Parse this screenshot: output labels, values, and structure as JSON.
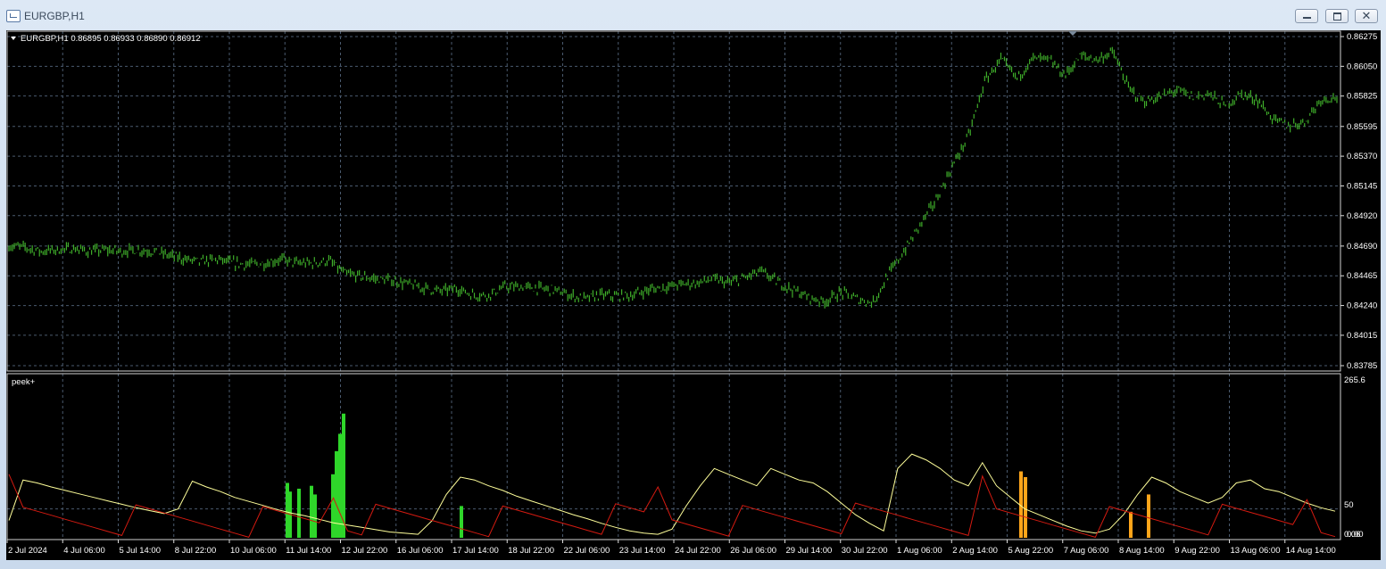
{
  "window": {
    "title": "EURGBP,H1",
    "minimize_label": "",
    "maximize_label": "",
    "close_label": "✕"
  },
  "price_panel": {
    "header": "EURGBP,H1  0.86895 0.86933 0.86890 0.86912",
    "y_ticks": [
      "0.86275",
      "0.86050",
      "0.85825",
      "0.85595",
      "0.85370",
      "0.85145",
      "0.84920",
      "0.84690",
      "0.84465",
      "0.84240",
      "0.84015",
      "0.83785"
    ]
  },
  "indicator_panel": {
    "name": "peek+",
    "y_ticks": [
      "265.6",
      "50",
      "0.06",
      "0.00"
    ]
  },
  "time_axis": [
    "2 Jul 2024",
    "4 Jul 06:00",
    "5 Jul 14:00",
    "8 Jul 22:00",
    "10 Jul 06:00",
    "11 Jul 14:00",
    "12 Jul 22:00",
    "16 Jul 06:00",
    "17 Jul 14:00",
    "18 Jul 22:00",
    "22 Jul 06:00",
    "23 Jul 14:00",
    "24 Jul 22:00",
    "26 Jul 06:00",
    "29 Jul 14:00",
    "30 Jul 22:00",
    "1 Aug 06:00",
    "2 Aug 14:00",
    "5 Aug 22:00",
    "7 Aug 06:00",
    "8 Aug 14:00",
    "9 Aug 22:00",
    "13 Aug 06:00",
    "14 Aug 14:00"
  ],
  "colors": {
    "background": "#000000",
    "grid": "#4a5a6e",
    "price_bars": "#3fae2a",
    "text": "#ffffff",
    "line_yellow": "#ffff9a",
    "line_red": "#d41a10",
    "hist_green": "#2fd62a",
    "hist_orange": "#ffa51a"
  },
  "chart_data": {
    "type": "line",
    "series": [
      {
        "values": [
          0.8469,
          0.8468,
          0.8465,
          0.8466,
          0.8467,
          0.8465,
          0.8466,
          0.8465,
          0.8466,
          0.8465,
          0.8462,
          0.8459,
          0.8457,
          0.8459,
          0.8456,
          0.8455,
          0.8456,
          0.8459,
          0.8456,
          0.8456,
          0.8458,
          0.8448,
          0.8446,
          0.8444,
          0.8443,
          0.844,
          0.8437,
          0.8435,
          0.8437,
          0.8432,
          0.8432,
          0.8438,
          0.8438,
          0.8437,
          0.8436,
          0.8432,
          0.8429,
          0.8432,
          0.8431,
          0.8432,
          0.8436,
          0.8438,
          0.844,
          0.8441,
          0.8444,
          0.8441,
          0.8445,
          0.845,
          0.8442,
          0.8436,
          0.843,
          0.8427,
          0.8434,
          0.8429,
          0.8426,
          0.8448,
          0.8466,
          0.8486,
          0.8505,
          0.853,
          0.8553,
          0.8594,
          0.861,
          0.8596,
          0.8611,
          0.861,
          0.8598,
          0.8613,
          0.861,
          0.8616,
          0.8588,
          0.8578,
          0.8582,
          0.8587,
          0.8582,
          0.8584,
          0.8575,
          0.8584,
          0.858,
          0.8565,
          0.856,
          0.8563,
          0.858,
          0.8582
        ]
      },
      {
        "name": "peek+",
        "values": [
          30,
          100,
          95,
          88,
          82,
          76,
          70,
          64,
          58,
          52,
          47,
          42,
          50,
          98,
          88,
          80,
          70,
          63,
          56,
          49,
          43,
          38,
          32,
          26,
          22,
          18,
          14,
          10,
          8,
          6,
          30,
          75,
          105,
          100,
          90,
          82,
          72,
          64,
          56,
          48,
          40,
          33,
          25,
          18,
          12,
          8,
          6,
          15,
          55,
          90,
          120,
          110,
          100,
          90,
          120,
          110,
          100,
          95,
          80,
          60,
          40,
          25,
          12,
          120,
          145,
          135,
          120,
          100,
          90,
          130,
          90,
          70,
          50,
          40,
          30,
          20,
          12,
          8,
          15,
          40,
          75,
          105,
          95,
          80,
          70,
          60,
          70,
          95,
          100,
          85,
          80,
          70,
          60,
          52,
          46
        ]
      }
    ],
    "ylim": [
      0.83785,
      0.86275
    ]
  }
}
